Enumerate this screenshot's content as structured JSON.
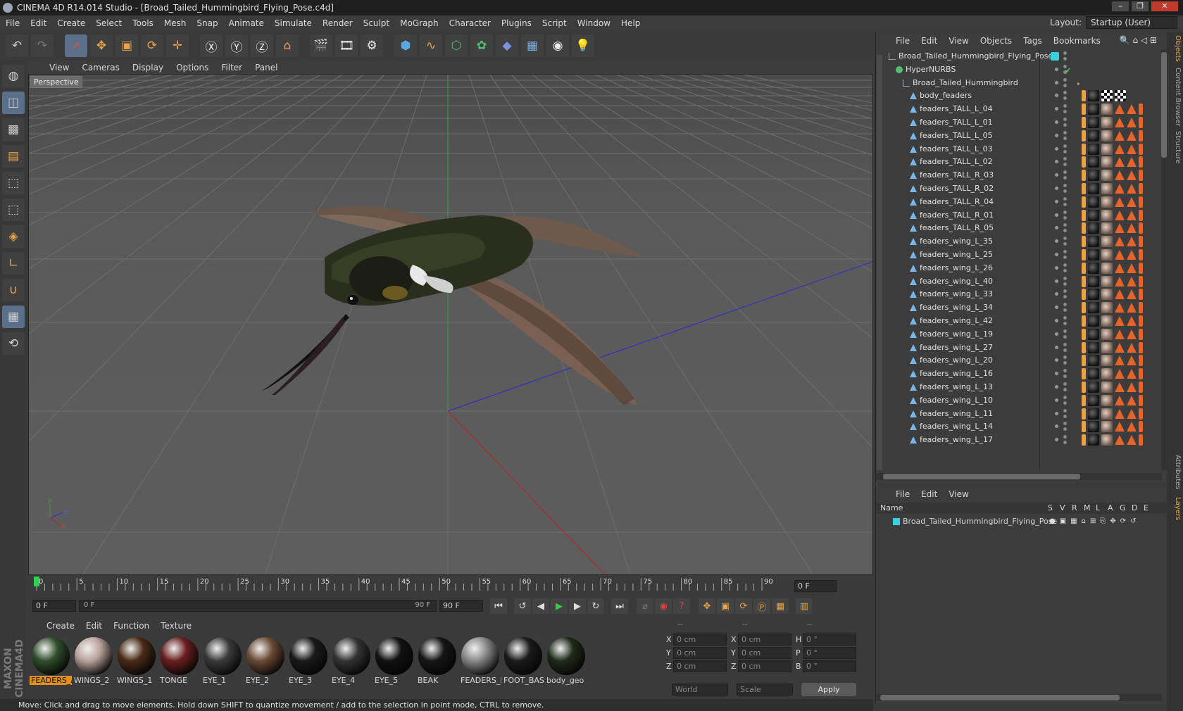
{
  "window": {
    "title": "CINEMA 4D R14.014 Studio - [Broad_Tailed_Hummingbird_Flying_Pose.c4d]"
  },
  "menu": [
    "File",
    "Edit",
    "Create",
    "Select",
    "Tools",
    "Mesh",
    "Snap",
    "Animate",
    "Simulate",
    "Render",
    "Sculpt",
    "MoGraph",
    "Character",
    "Plugins",
    "Script",
    "Window",
    "Help"
  ],
  "layout": {
    "label": "Layout:",
    "value": "Startup (User)"
  },
  "viewport": {
    "menu": [
      "View",
      "Cameras",
      "Display",
      "Options",
      "Filter",
      "Panel"
    ],
    "label": "Perspective"
  },
  "timeline": {
    "ticks": [
      "0",
      "5",
      "10",
      "15",
      "20",
      "25",
      "30",
      "35",
      "40",
      "45",
      "50",
      "55",
      "60",
      "65",
      "70",
      "75",
      "80",
      "85",
      "90"
    ],
    "current_frame": "0 F"
  },
  "transport": {
    "start": "0 F",
    "range_start": "0 F",
    "range_end": "90 F",
    "end": "90 F"
  },
  "materials": {
    "menu": [
      "Create",
      "Edit",
      "Function",
      "Texture"
    ],
    "items": [
      {
        "name": "FEADERS_A",
        "color": "#2f4d2a",
        "sel": true
      },
      {
        "name": "WINGS_2",
        "color": "#b7a29a",
        "sel": false
      },
      {
        "name": "WINGS_1",
        "color": "#4a2a17",
        "sel": false
      },
      {
        "name": "TONGE",
        "color": "#6a1e1e",
        "sel": false
      },
      {
        "name": "EYE_1",
        "color": "#3a3a3a",
        "sel": false
      },
      {
        "name": "EYE_2",
        "color": "#6a4a35",
        "sel": false
      },
      {
        "name": "EYE_3",
        "color": "#1a1a1a",
        "sel": false
      },
      {
        "name": "EYE_4",
        "color": "#333",
        "sel": false
      },
      {
        "name": "EYE_5",
        "color": "#111",
        "sel": false
      },
      {
        "name": "BEAK",
        "color": "#151515",
        "sel": false
      },
      {
        "name": "FEADERS_F",
        "color": "#888",
        "sel": false
      },
      {
        "name": "FOOT_BASI",
        "color": "#1b1b1b",
        "sel": false
      },
      {
        "name": "body_geo",
        "color": "#1f2a1a",
        "sel": false
      }
    ]
  },
  "coords": {
    "headers": [
      "--",
      "--",
      "--"
    ],
    "rows": [
      {
        "a": "X",
        "av": "0 cm",
        "b": "X",
        "bv": "0 cm",
        "c": "H",
        "cv": "0 °"
      },
      {
        "a": "Y",
        "av": "0 cm",
        "b": "Y",
        "bv": "0 cm",
        "c": "P",
        "cv": "0 °"
      },
      {
        "a": "Z",
        "av": "0 cm",
        "b": "Z",
        "bv": "0 cm",
        "c": "B",
        "cv": "0 °"
      }
    ],
    "world": "World",
    "scale": "Scale",
    "apply": "Apply"
  },
  "status": "Move: Click and drag to move elements. Hold down SHIFT to quantize movement / add to the selection in point mode, CTRL to remove.",
  "objects": {
    "menu": [
      "File",
      "Edit",
      "View",
      "Objects",
      "Tags",
      "Bookmarks"
    ],
    "items": [
      {
        "name": "Broad_Tailed_Hummingbird_Flying_Pose",
        "indent": 0,
        "kind": "null"
      },
      {
        "name": "HyperNURBS",
        "indent": 1,
        "kind": "nurbs"
      },
      {
        "name": "Broad_Tailed_Hummingbird",
        "indent": 2,
        "kind": "null"
      },
      {
        "name": "body_feaders",
        "indent": 3,
        "kind": "poly"
      },
      {
        "name": "feaders_TALL_L_04",
        "indent": 3,
        "kind": "poly"
      },
      {
        "name": "feaders_TALL_L_01",
        "indent": 3,
        "kind": "poly"
      },
      {
        "name": "feaders_TALL_L_05",
        "indent": 3,
        "kind": "poly"
      },
      {
        "name": "feaders_TALL_L_03",
        "indent": 3,
        "kind": "poly"
      },
      {
        "name": "feaders_TALL_L_02",
        "indent": 3,
        "kind": "poly"
      },
      {
        "name": "feaders_TALL_R_03",
        "indent": 3,
        "kind": "poly"
      },
      {
        "name": "feaders_TALL_R_02",
        "indent": 3,
        "kind": "poly"
      },
      {
        "name": "feaders_TALL_R_04",
        "indent": 3,
        "kind": "poly"
      },
      {
        "name": "feaders_TALL_R_01",
        "indent": 3,
        "kind": "poly"
      },
      {
        "name": "feaders_TALL_R_05",
        "indent": 3,
        "kind": "poly"
      },
      {
        "name": "feaders_wing_L_35",
        "indent": 3,
        "kind": "poly"
      },
      {
        "name": "feaders_wing_L_25",
        "indent": 3,
        "kind": "poly"
      },
      {
        "name": "feaders_wing_L_26",
        "indent": 3,
        "kind": "poly"
      },
      {
        "name": "feaders_wing_L_40",
        "indent": 3,
        "kind": "poly"
      },
      {
        "name": "feaders_wing_L_33",
        "indent": 3,
        "kind": "poly"
      },
      {
        "name": "feaders_wing_L_34",
        "indent": 3,
        "kind": "poly"
      },
      {
        "name": "feaders_wing_L_42",
        "indent": 3,
        "kind": "poly"
      },
      {
        "name": "feaders_wing_L_19",
        "indent": 3,
        "kind": "poly"
      },
      {
        "name": "feaders_wing_L_27",
        "indent": 3,
        "kind": "poly"
      },
      {
        "name": "feaders_wing_L_20",
        "indent": 3,
        "kind": "poly"
      },
      {
        "name": "feaders_wing_L_16",
        "indent": 3,
        "kind": "poly"
      },
      {
        "name": "feaders_wing_L_13",
        "indent": 3,
        "kind": "poly"
      },
      {
        "name": "feaders_wing_L_10",
        "indent": 3,
        "kind": "poly"
      },
      {
        "name": "feaders_wing_L_11",
        "indent": 3,
        "kind": "poly"
      },
      {
        "name": "feaders_wing_L_14",
        "indent": 3,
        "kind": "poly"
      },
      {
        "name": "feaders_wing_L_17",
        "indent": 3,
        "kind": "poly"
      }
    ]
  },
  "layers": {
    "menu": [
      "File",
      "Edit",
      "View"
    ],
    "name_header": "Name",
    "flags": [
      "S",
      "V",
      "R",
      "M",
      "L",
      "A",
      "G",
      "D",
      "E"
    ],
    "items": [
      {
        "name": "Broad_Tailed_Hummingbird_Flying_Pose"
      }
    ]
  },
  "sidetabs": [
    "Objects",
    "Content Browser",
    "Structure",
    "Attributes",
    "Layers"
  ]
}
